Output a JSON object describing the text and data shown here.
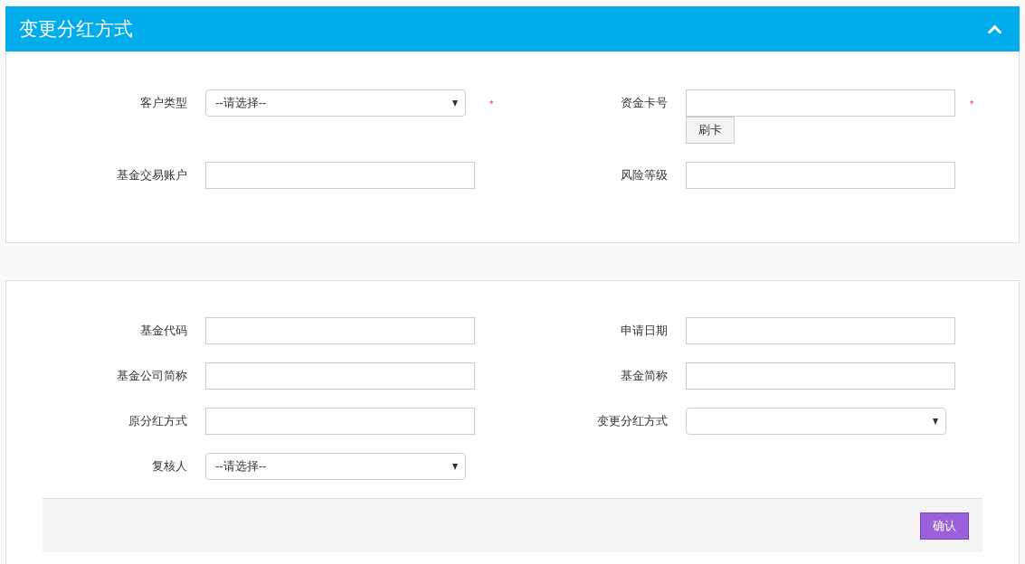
{
  "panel": {
    "title": "变更分红方式",
    "collapsed": false
  },
  "cards": [
    {
      "fields": [
        {
          "label": "客户类型",
          "kind": "select",
          "value": "--请选择--",
          "required_mark": "*"
        },
        {
          "label": "资金卡号",
          "kind": "input",
          "required_mark": "*",
          "button": "刷卡"
        },
        {
          "label": "基金交易账户",
          "kind": "input"
        },
        {
          "label": "风险等级",
          "kind": "input"
        }
      ]
    },
    {
      "fields": [
        {
          "label": "基金代码",
          "kind": "input"
        },
        {
          "label": "申请日期",
          "kind": "input"
        },
        {
          "label": "基金公司简称",
          "kind": "input"
        },
        {
          "label": "基金简称",
          "kind": "input"
        },
        {
          "label": "原分红方式",
          "kind": "input"
        },
        {
          "label": "变更分红方式",
          "kind": "select"
        },
        {
          "label": "复核人",
          "kind": "select",
          "value": "--请选择--"
        }
      ],
      "footer": {
        "button": "确认"
      }
    }
  ]
}
